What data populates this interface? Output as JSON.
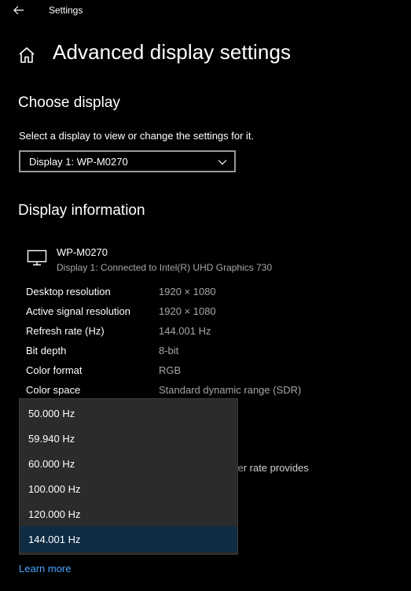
{
  "window": {
    "app_title": "Settings"
  },
  "page": {
    "title": "Advanced display settings"
  },
  "choose_display": {
    "heading": "Choose display",
    "description": "Select a display to view or change the settings for it.",
    "selected_display": "Display 1: WP-M0270"
  },
  "display_information": {
    "heading": "Display information",
    "monitor_name": "WP-M0270",
    "monitor_connection": "Display 1: Connected to Intel(R) UHD Graphics 730",
    "rows": [
      {
        "label": "Desktop resolution",
        "value": "1920 × 1080"
      },
      {
        "label": "Active signal resolution",
        "value": "1920 × 1080"
      },
      {
        "label": "Refresh rate (Hz)",
        "value": "144.001 Hz"
      },
      {
        "label": "Bit depth",
        "value": "8-bit"
      },
      {
        "label": "Color format",
        "value": "RGB"
      },
      {
        "label": "Color space",
        "value": "Standard dynamic range (SDR)"
      }
    ]
  },
  "refresh_rate": {
    "partial_description": "gher rate provides",
    "options": [
      "50.000 Hz",
      "59.940 Hz",
      "60.000 Hz",
      "100.000 Hz",
      "120.000 Hz",
      "144.001 Hz"
    ],
    "selected": "144.001 Hz"
  },
  "links": {
    "learn_more": "Learn more"
  },
  "colors": {
    "background": "#000000",
    "text_primary": "#ffffff",
    "text_secondary": "#a6a6a6",
    "dropdown_background": "#2b2b2b",
    "selected_option_background": "#0f2c45",
    "link": "#4aa3ff"
  },
  "icons": {
    "back": "back-arrow-icon",
    "home": "home-icon",
    "chevron": "chevron-down-icon",
    "monitor": "monitor-icon"
  }
}
